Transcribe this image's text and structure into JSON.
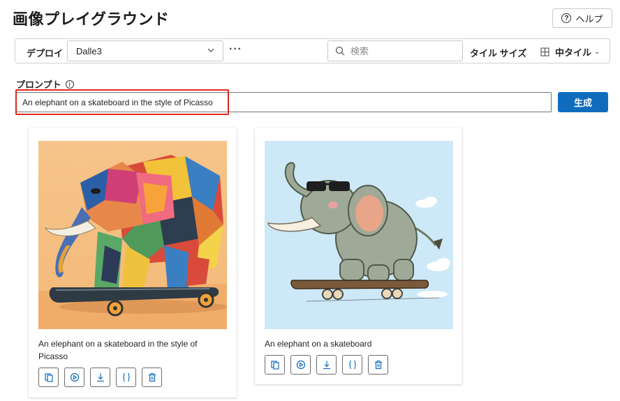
{
  "page": {
    "title": "画像プレイグラウンド"
  },
  "help": {
    "label": "ヘルプ",
    "icon": "question-circle-icon"
  },
  "toolbar": {
    "deploy_label": "デプロイ",
    "deploy_value": "Dalle3",
    "more_label": "···",
    "search_placeholder": "検索",
    "tile_size_label": "タイル サイズ",
    "tile_size_value": "中タイル"
  },
  "prompt": {
    "label": "プロンプト",
    "value": "An elephant on a skateboard in the style of Picasso",
    "generate_label": "生成"
  },
  "images": [
    {
      "caption": "An elephant on a skateboard in the style of Picasso",
      "style": "cubist"
    },
    {
      "caption": "An elephant on a skateboard",
      "style": "cartoon"
    }
  ],
  "card_actions": [
    "copy-icon",
    "play-icon",
    "download-icon",
    "code-icon",
    "delete-icon"
  ],
  "colors": {
    "accent": "#0f6cbd",
    "highlight": "#e0281e"
  }
}
